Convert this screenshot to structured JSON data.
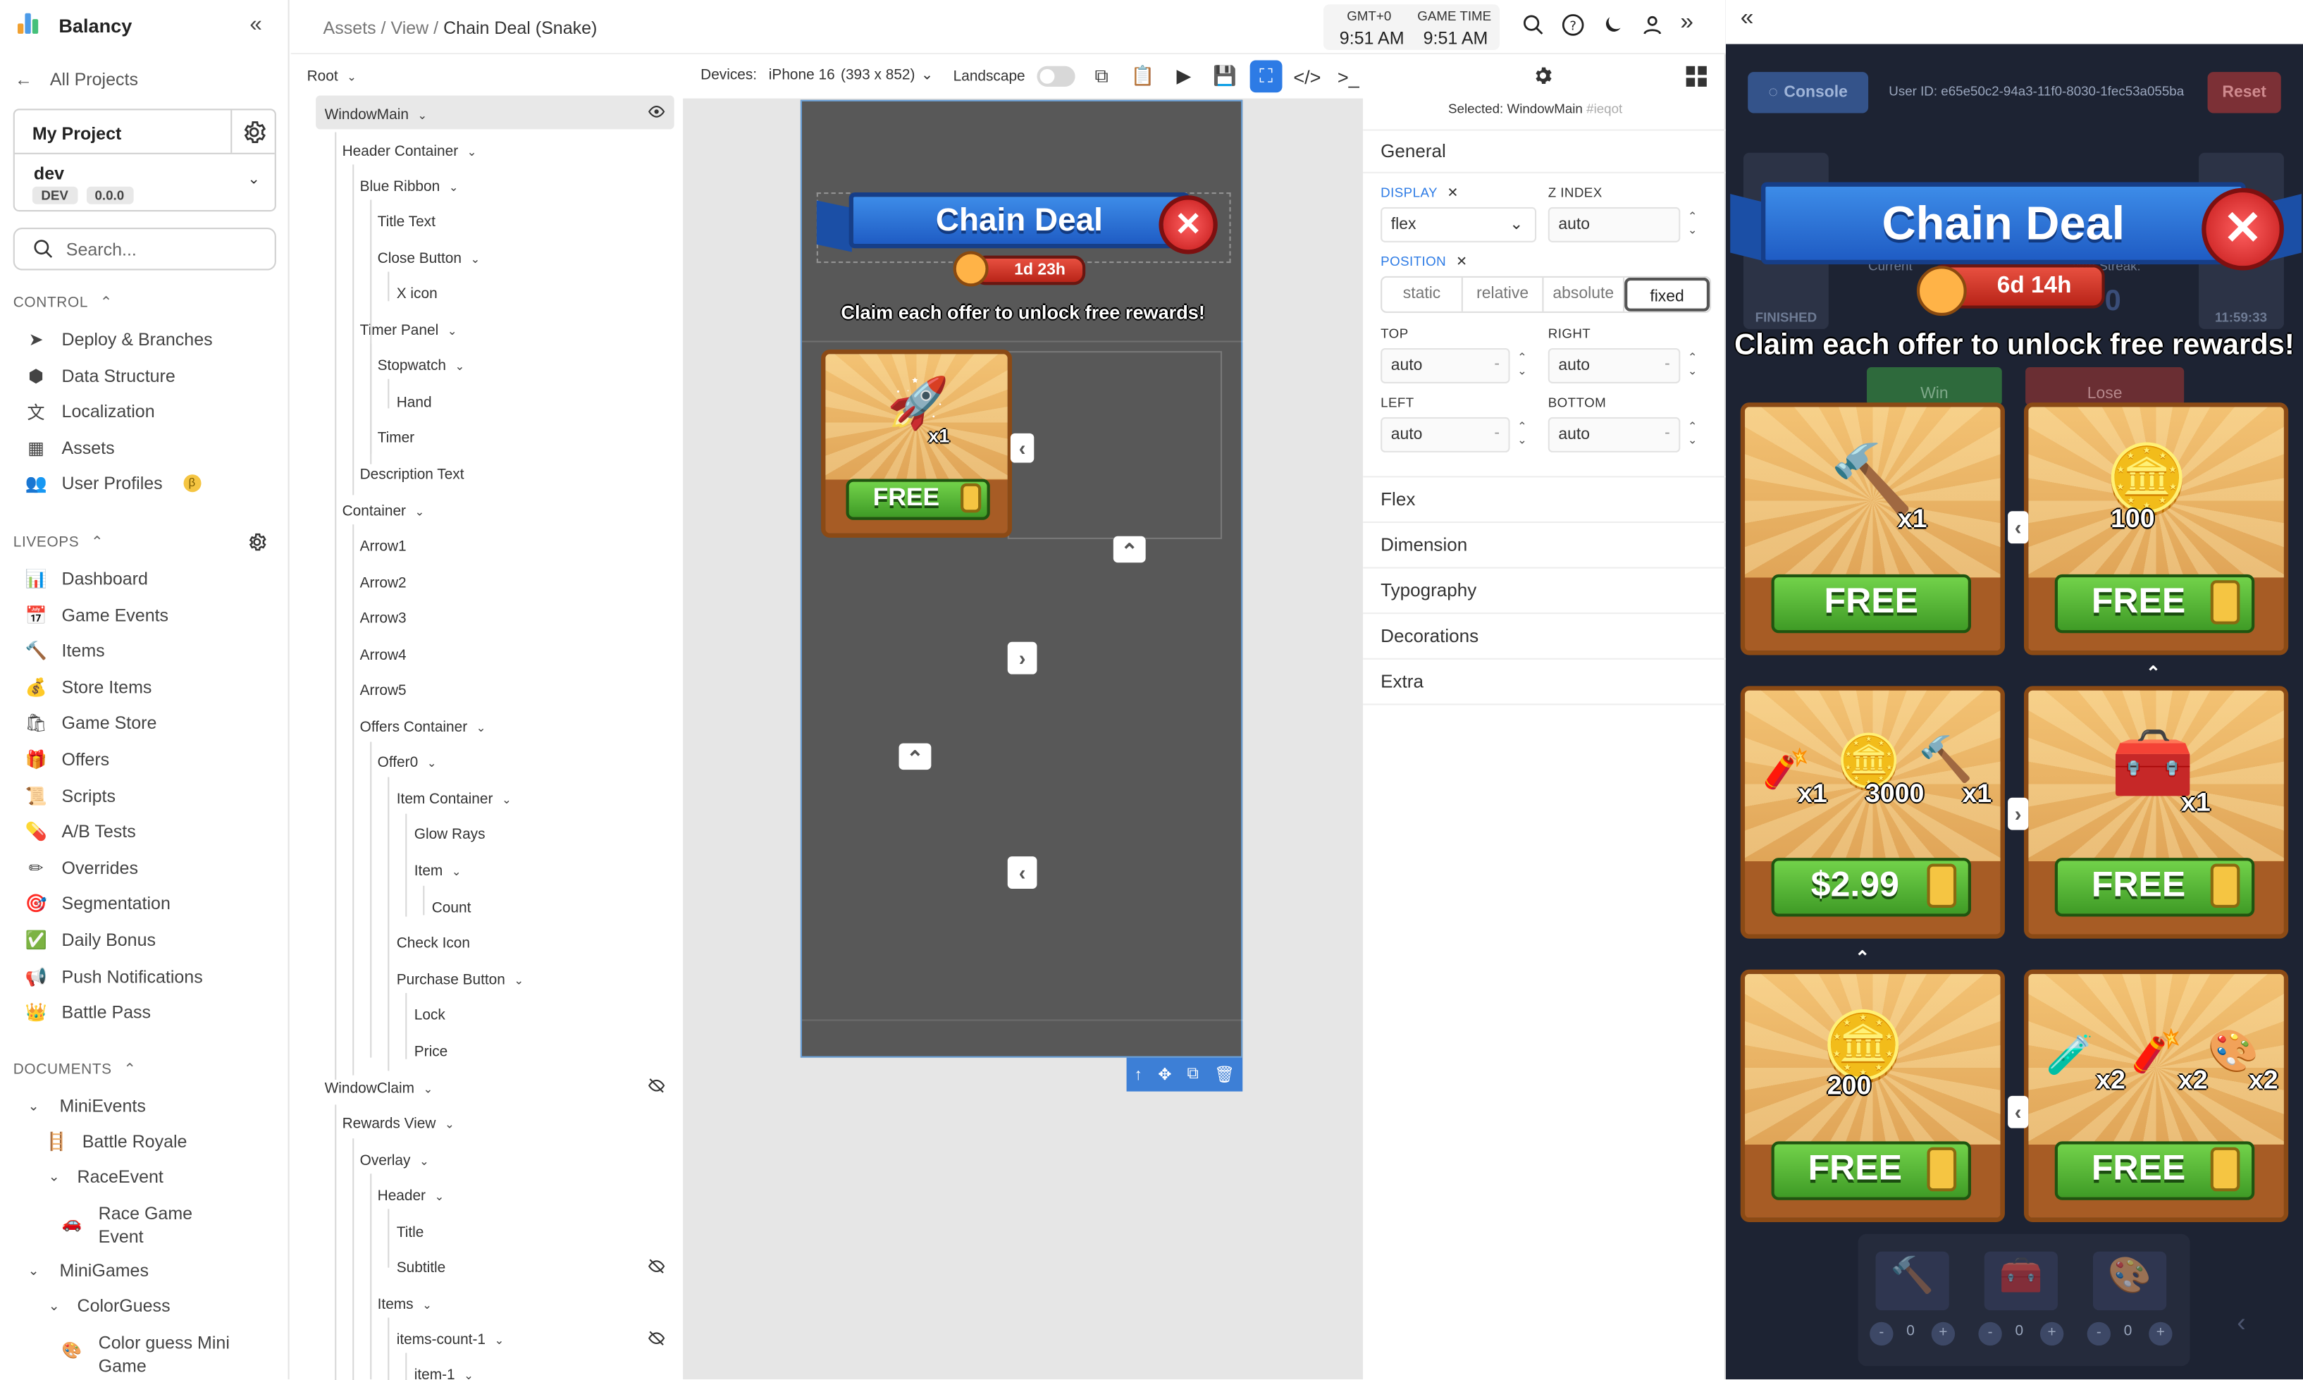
{
  "sidebar": {
    "brand": "Balancy",
    "all_projects": "All Projects",
    "project_name": "My Project",
    "env_name": "dev",
    "env_badge": "DEV",
    "env_version": "0.0.0",
    "search_placeholder": "Search...",
    "control_label": "CONTROL",
    "control_items": [
      {
        "label": "Deploy & Branches",
        "icon": "paper-plane-icon"
      },
      {
        "label": "Data Structure",
        "icon": "cube-icon"
      },
      {
        "label": "Localization",
        "icon": "translate-icon"
      },
      {
        "label": "Assets",
        "icon": "assets-icon"
      },
      {
        "label": "User Profiles",
        "icon": "users-icon",
        "beta": "β"
      }
    ],
    "liveops_label": "LIVEOPS",
    "liveops_items": [
      {
        "label": "Dashboard",
        "icon": "chart-icon",
        "glyph": "📊"
      },
      {
        "label": "Game Events",
        "icon": "calendar-icon",
        "glyph": "📅"
      },
      {
        "label": "Items",
        "icon": "hammer-icon",
        "glyph": "🔨"
      },
      {
        "label": "Store Items",
        "icon": "money-bag-icon",
        "glyph": "💰"
      },
      {
        "label": "Game Store",
        "icon": "shopping-bags-icon",
        "glyph": "🛍"
      },
      {
        "label": "Offers",
        "icon": "gift-icon",
        "glyph": "🎁"
      },
      {
        "label": "Scripts",
        "icon": "scroll-icon",
        "glyph": "📜"
      },
      {
        "label": "A/B Tests",
        "icon": "pill-icon",
        "glyph": "💊"
      },
      {
        "label": "Overrides",
        "icon": "pencil-icon",
        "glyph": "✏"
      },
      {
        "label": "Segmentation",
        "icon": "target-icon",
        "glyph": "🎯"
      },
      {
        "label": "Daily Bonus",
        "icon": "check-box-icon",
        "glyph": "✅"
      },
      {
        "label": "Push Notifications",
        "icon": "megaphone-icon",
        "glyph": "📢"
      },
      {
        "label": "Battle Pass",
        "icon": "crown-icon",
        "glyph": "👑"
      }
    ],
    "documents_label": "DOCUMENTS",
    "documents": {
      "minievents": "MiniEvents",
      "battle_royale": "Battle Royale",
      "race_event": "RaceEvent",
      "race_game_event_1": "Race Game",
      "race_game_event_2": "Event",
      "minigames": "MiniGames",
      "color_guess": "ColorGuess",
      "color_guess_mini_1": "Color guess Mini",
      "color_guess_mini_2": "Game"
    }
  },
  "topbar": {
    "crumb_assets": "Assets",
    "crumb_view": "View",
    "crumb_current": "Chain Deal (Snake)",
    "gmt_label": "GMT+0",
    "gmt_time": "9:51 AM",
    "game_label": "GAME TIME",
    "game_time": "9:51 AM"
  },
  "tree": {
    "root": "Root",
    "nodes": [
      "WindowMain",
      "Header Container",
      "Blue Ribbon",
      "Title Text",
      "Close Button",
      "X icon",
      "Timer Panel",
      "Stopwatch",
      "Hand",
      "Timer",
      "Description Text",
      "Container",
      "Arrow1",
      "Arrow2",
      "Arrow3",
      "Arrow4",
      "Arrow5",
      "Offers Container",
      "Offer0",
      "Item Container",
      "Glow Rays",
      "Item",
      "Count",
      "Check Icon",
      "Purchase Button",
      "Lock",
      "Price",
      "WindowClaim",
      "Rewards View",
      "Overlay",
      "Header",
      "Title",
      "Subtitle",
      "Items",
      "items-count-1",
      "item-1"
    ]
  },
  "canvasbar": {
    "devices_label": "Devices:",
    "device": "iPhone 16",
    "device_size": "(393 x 852)",
    "landscape_label": "Landscape"
  },
  "game": {
    "title": "Chain Deal",
    "timer_small": "1d 23h",
    "timer_big": "6d 14h",
    "description": "Claim each offer to unlock free rewards!",
    "offer0_count": "x1",
    "free": "FREE",
    "offers": [
      {
        "counts": [
          "x1"
        ],
        "price": "FREE",
        "lock": false
      },
      {
        "counts": [
          "100"
        ],
        "price": "FREE",
        "lock": true
      },
      {
        "counts": [
          "x1",
          "3000",
          "x1"
        ],
        "price": "$2.99",
        "lock": true
      },
      {
        "counts": [
          "x1"
        ],
        "price": "FREE",
        "lock": true
      },
      {
        "counts": [
          "200"
        ],
        "price": "FREE",
        "lock": true
      },
      {
        "counts": [
          "x2",
          "x2",
          "x2"
        ],
        "price": "FREE",
        "lock": true
      }
    ]
  },
  "props": {
    "selected_label": "Selected:",
    "selected_name": "WindowMain",
    "selected_id": "#ieqot",
    "general": "General",
    "display_label": "DISPLAY",
    "display_value": "flex",
    "zindex_label": "Z INDEX",
    "zindex_value": "auto",
    "position_label": "POSITION",
    "position_options": [
      "static",
      "relative",
      "absolute",
      "fixed"
    ],
    "top_label": "TOP",
    "top_value": "auto",
    "right_label": "RIGHT",
    "right_value": "auto",
    "left_label": "LEFT",
    "left_value": "auto",
    "bottom_label": "BOTTOM",
    "bottom_value": "auto",
    "sections": [
      "Flex",
      "Dimension",
      "Typography",
      "Decorations",
      "Extra"
    ]
  },
  "preview": {
    "console": "Console",
    "user_id": "User ID: e65e50c2-94a3-11f0-8030-1fec53a055ba",
    "reset": "Reset",
    "ghost_finished": "FINISHED",
    "ghost_current": "Current",
    "ghost_win_streak": "Win Streak:",
    "ghost_zero": "0",
    "ghost_time": "11:59:33",
    "ghost_win": "Win",
    "ghost_lose": "Lose",
    "stepper_values": [
      "0",
      "0",
      "0"
    ],
    "stepper_minus": "-",
    "stepper_plus": "+"
  }
}
